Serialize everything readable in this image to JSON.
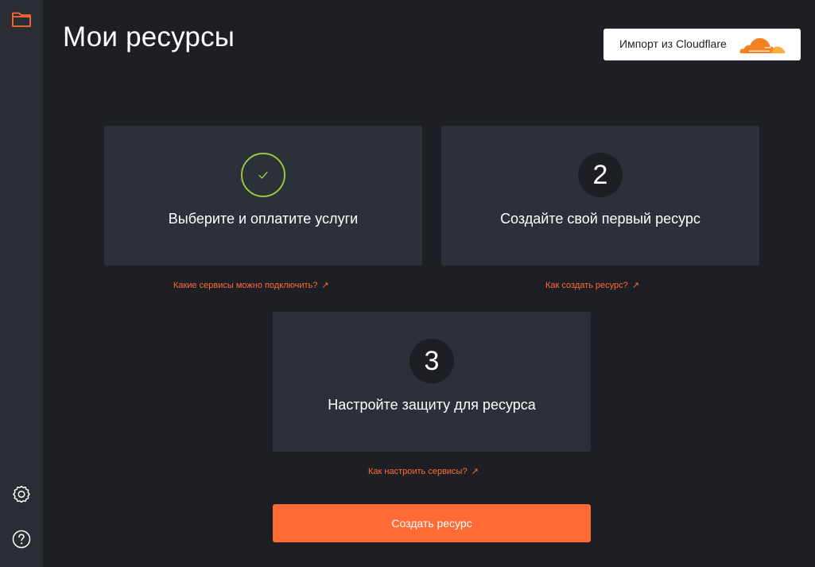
{
  "header": {
    "title": "Мои ресурсы",
    "import_label": "Импорт из Cloudflare"
  },
  "steps": [
    {
      "badge": "✓",
      "status": "done",
      "title": "Выберите и оплатите услуги",
      "link": "Какие сервисы можно подключить?"
    },
    {
      "badge": "2",
      "status": "pending",
      "title": "Создайте свой первый ресурс",
      "link": "Как создать ресурс?"
    },
    {
      "badge": "3",
      "status": "pending",
      "title": "Настройте защиту для ресурса",
      "link": "Как настроить сервисы?"
    }
  ],
  "link_arrow": "↗",
  "create_button": "Создать ресурс",
  "sidebar": {
    "icons": [
      "folder-icon",
      "settings-icon",
      "help-icon"
    ]
  },
  "colors": {
    "accent": "#ff6b35",
    "success": "#9bc53d",
    "background": "#1d1f24",
    "sidebar": "#2a2d34",
    "card": "#2c3038",
    "cloudflare_orange": "#f48120"
  }
}
